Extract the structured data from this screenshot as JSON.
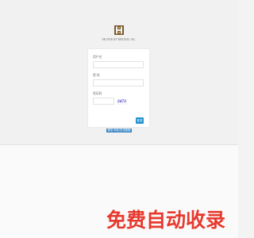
{
  "brand": {
    "name": "HONESTMEDICAL",
    "icon": "hs-monogram-logo",
    "colors": {
      "logo": "#7a5a2a"
    }
  },
  "login": {
    "username_label": "用户名",
    "username_value": "",
    "password_label": "密 码",
    "password_value": "",
    "captcha_label": "验证码",
    "captcha_value": "",
    "captcha_text": "2473",
    "submit_label": "登录"
  },
  "footer": {
    "link_text": "微信 网站/在线客服"
  },
  "watermark": {
    "text": "免费自动收录",
    "color": "#e63a2f"
  },
  "colors": {
    "accent": "#2290cf",
    "link_bg": "#3b86c4"
  }
}
